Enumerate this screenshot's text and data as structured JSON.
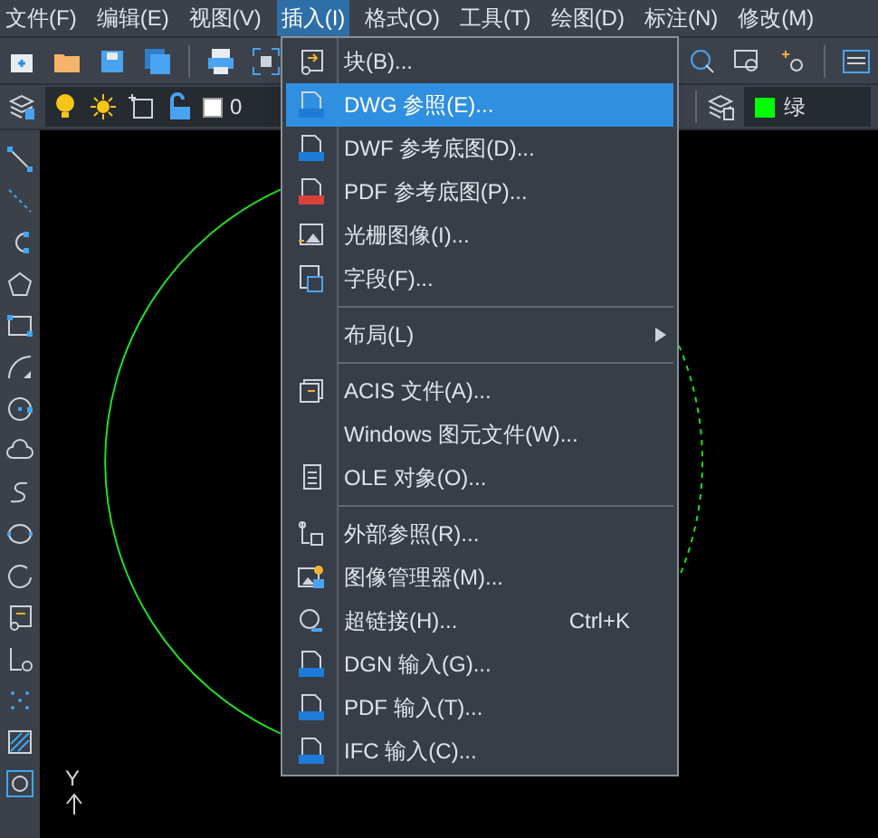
{
  "menubar": [
    {
      "label": "文件(F)",
      "selected": false
    },
    {
      "label": "编辑(E)",
      "selected": false
    },
    {
      "label": "视图(V)",
      "selected": false
    },
    {
      "label": "插入(I)",
      "selected": true
    },
    {
      "label": "格式(O)",
      "selected": false
    },
    {
      "label": "工具(T)",
      "selected": false
    },
    {
      "label": "绘图(D)",
      "selected": false
    },
    {
      "label": "标注(N)",
      "selected": false
    },
    {
      "label": "修改(M)",
      "selected": false
    }
  ],
  "layer_combo": {
    "value": "0"
  },
  "color_combo": {
    "value": "绿",
    "color": "#00ff00"
  },
  "menu": [
    {
      "kind": "item",
      "label": "块(B)...",
      "selected": false
    },
    {
      "kind": "item",
      "label": "DWG 参照(E)...",
      "selected": true
    },
    {
      "kind": "item",
      "label": "DWF 参考底图(D)...",
      "selected": false
    },
    {
      "kind": "item",
      "label": "PDF 参考底图(P)...",
      "selected": false
    },
    {
      "kind": "item",
      "label": "光栅图像(I)...",
      "selected": false
    },
    {
      "kind": "item",
      "label": "字段(F)...",
      "selected": false
    },
    {
      "kind": "separator"
    },
    {
      "kind": "submenu",
      "label": "布局(L)",
      "selected": false
    },
    {
      "kind": "separator"
    },
    {
      "kind": "item",
      "label": "ACIS 文件(A)...",
      "selected": false
    },
    {
      "kind": "item",
      "label": "Windows 图元文件(W)...",
      "selected": false
    },
    {
      "kind": "item",
      "label": "OLE 对象(O)...",
      "selected": false
    },
    {
      "kind": "separator"
    },
    {
      "kind": "item",
      "label": "外部参照(R)...",
      "selected": false
    },
    {
      "kind": "item",
      "label": "图像管理器(M)...",
      "selected": false
    },
    {
      "kind": "item",
      "label": "超链接(H)...",
      "shortcut": "Ctrl+K",
      "selected": false
    },
    {
      "kind": "item",
      "label": "DGN 输入(G)...",
      "selected": false
    },
    {
      "kind": "item",
      "label": "PDF 输入(T)...",
      "selected": false
    },
    {
      "kind": "item",
      "label": "IFC 输入(C)...",
      "selected": false
    }
  ],
  "ucs_label": "Y"
}
